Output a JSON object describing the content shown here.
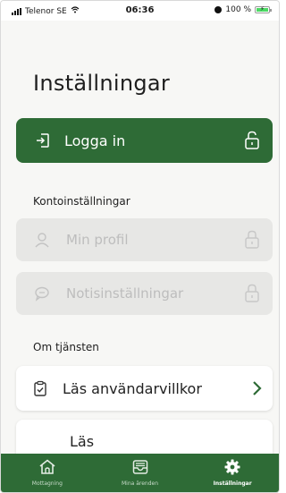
{
  "status_bar": {
    "carrier": "Telenor SE",
    "time": "06:36",
    "battery": "100 %"
  },
  "page": {
    "title": "Inställningar"
  },
  "login": {
    "label": "Logga in"
  },
  "account_section": {
    "heading": "Kontoinställningar",
    "items": [
      {
        "label": "Min profil",
        "icon": "person-icon"
      },
      {
        "label": "Notisinställningar",
        "icon": "chat-bubble-icon"
      }
    ]
  },
  "service_section": {
    "heading": "Om tjänsten",
    "items": [
      {
        "label": "Läs användarvillkor",
        "icon": "clipboard-check-icon"
      },
      {
        "label": "Läs"
      }
    ]
  },
  "colors": {
    "brand_green": "#2e6b36",
    "disabled_bg": "#e7e7e5"
  },
  "tabbar": {
    "tabs": [
      {
        "label": "Mottagning",
        "icon": "house-icon"
      },
      {
        "label": "Mina ärenden",
        "icon": "inbox-tray-icon"
      },
      {
        "label": "Inställningar",
        "icon": "gear-icon",
        "active": true
      }
    ]
  }
}
